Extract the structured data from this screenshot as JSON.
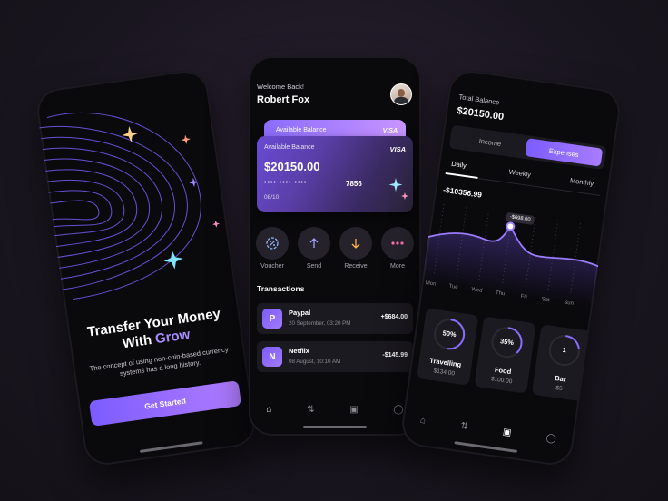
{
  "onboarding": {
    "title_line1": "Transfer Your Money",
    "title_line2_prefix": "With ",
    "title_highlight": "Grow",
    "subtitle": "The concept of using non-coin-based currency systems has a long history.",
    "cta_label": "Get Started"
  },
  "home": {
    "greeting": "Welcome Back!",
    "user_name": "Robert Fox",
    "back_card": {
      "label": "Available Balance",
      "brand": "VISA"
    },
    "card": {
      "label": "Available Balance",
      "brand": "VISA",
      "balance": "$20150.00",
      "masked": "•••• •••• ••••",
      "last4": "7856",
      "expiry": "08/10"
    },
    "actions": [
      {
        "label": "Voucher",
        "icon": "voucher-icon"
      },
      {
        "label": "Send",
        "icon": "arrow-up-icon"
      },
      {
        "label": "Receive",
        "icon": "arrow-down-icon"
      },
      {
        "label": "More",
        "icon": "more-icon"
      }
    ],
    "transactions_title": "Transactions",
    "transactions": [
      {
        "name": "Paypal",
        "date": "20 September, 03:20 PM",
        "amount": "+$684.00",
        "icon": "paypal-icon",
        "glyph": "P"
      },
      {
        "name": "Netflix",
        "date": "08 August, 10:10 AM",
        "amount": "-$145.99",
        "icon": "netflix-icon",
        "glyph": "N"
      }
    ]
  },
  "stats": {
    "total_label": "Total Balance",
    "total_value": "$20150.00",
    "tabs": [
      "Income",
      "Expenses"
    ],
    "periods": [
      "Daily",
      "Weekly",
      "Monthly"
    ],
    "chart_value": "-$10356.99",
    "tooltip": "-$698.00",
    "days": [
      "Mon",
      "Tue",
      "Wed",
      "Thu",
      "Fri",
      "Sat",
      "Sun"
    ],
    "categories": [
      {
        "name": "Travelling",
        "percent": "50%",
        "amount": "$134.00",
        "fraction": 0.5
      },
      {
        "name": "Food",
        "percent": "35%",
        "amount": "$100.00",
        "fraction": 0.35
      },
      {
        "name": "Bar",
        "percent": "1",
        "amount": "$5",
        "fraction": 0.2
      }
    ]
  },
  "colors": {
    "accent": "#7c5cff",
    "accent2": "#b07cff",
    "bg": "#0a090c"
  }
}
